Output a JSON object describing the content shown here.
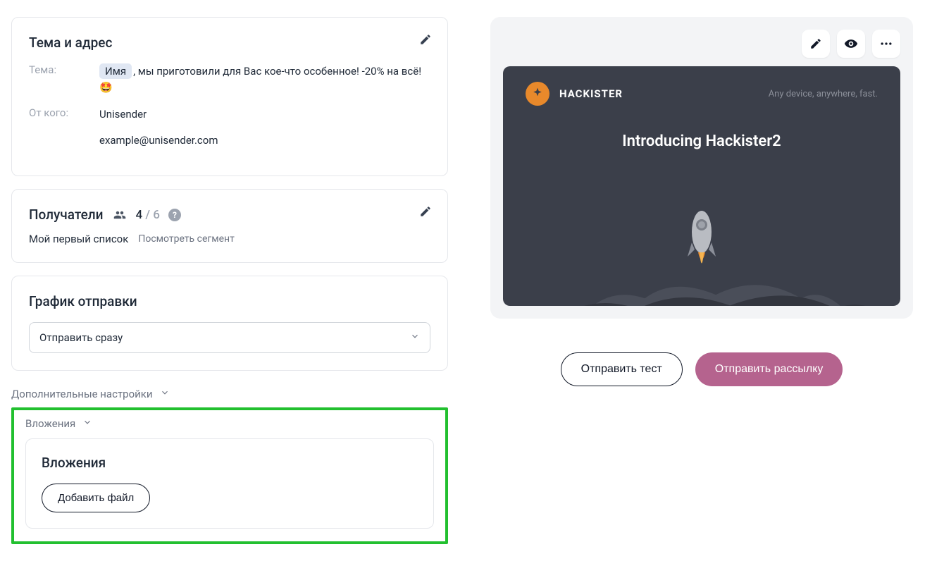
{
  "subject_card": {
    "title": "Тема и адрес",
    "subject_label": "Тема:",
    "subject_chip": "Имя",
    "subject_rest": ", мы приготовили для Вас кое-что особенное! -20% на всё!🤩",
    "from_label": "От кого:",
    "from_name": "Unisender",
    "from_email": "example@unisender.com"
  },
  "recipients": {
    "title": "Получатели",
    "active": "4",
    "sep": " / ",
    "total": "6",
    "list_name": "Мой первый список",
    "segment_link": "Посмотреть сегмент"
  },
  "schedule": {
    "title": "График отправки",
    "selected": "Отправить сразу"
  },
  "expanders": {
    "advanced": "Дополнительные настройки",
    "attachments_toggle": "Вложения"
  },
  "attachments": {
    "title": "Вложения",
    "add_button": "Добавить файл"
  },
  "preview": {
    "brand": "HACKISTER",
    "tagline": "Any device, anywhere, fast.",
    "hero": "Introducing Hackister2"
  },
  "actions": {
    "test": "Отправить тест",
    "send": "Отправить рассылку"
  }
}
